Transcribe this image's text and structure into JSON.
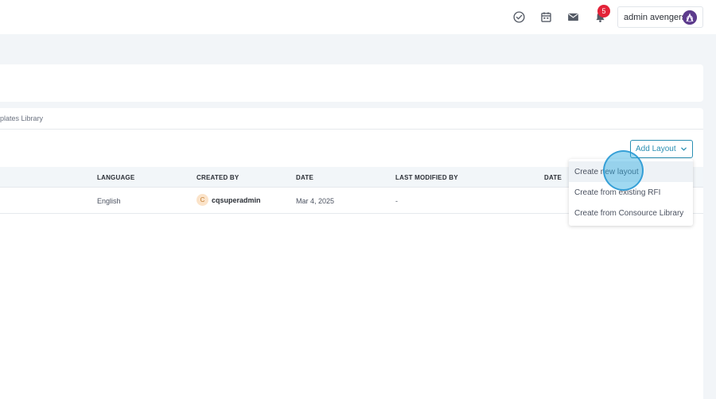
{
  "header": {
    "notification_count": "5",
    "user_name": "admin avengers",
    "icons": [
      "check-circle-icon",
      "calendar-icon",
      "mail-icon",
      "bell-icon"
    ]
  },
  "breadcrumb": {
    "label": "plates Library"
  },
  "toolbar": {
    "add_layout_label": "Add Layout"
  },
  "table": {
    "columns": [
      "LANGUAGE",
      "CREATED BY",
      "DATE",
      "LAST MODIFIED BY",
      "DATE"
    ],
    "rows": [
      {
        "language": "English",
        "created_by_initial": "C",
        "created_by": "cqsuperadmin",
        "date": "Mar 4, 2025",
        "last_modified_by": "-"
      }
    ]
  },
  "dropdown": {
    "items": [
      {
        "label": "Create new layout"
      },
      {
        "label": "Create from existing RFI"
      },
      {
        "label": "Create from Consource Library"
      }
    ]
  },
  "colors": {
    "accent": "#2a8fb3",
    "badge": "#e32238",
    "background": "#f2f5f8"
  }
}
